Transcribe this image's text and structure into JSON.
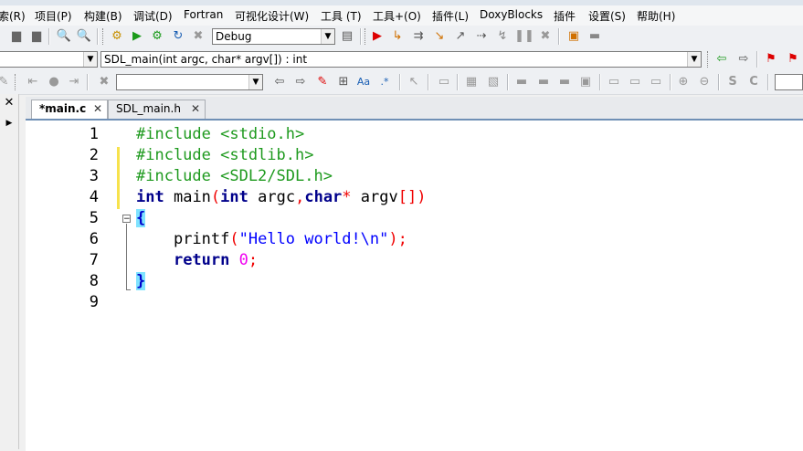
{
  "menu": [
    "索(R)",
    "项目(P)",
    "构建(B)",
    "调试(D)",
    "Fortran",
    "可视化设计(W)",
    "工具 (T)",
    "工具+(O)",
    "插件(L)",
    "DoxyBlocks",
    "插件",
    "设置(S)",
    "帮助(H)"
  ],
  "toolbar1": {
    "build_target": "Debug"
  },
  "toolbar2": {
    "symbol_combo": "SDL_main(int argc, char* argv[]) : int"
  },
  "toolbar3": {
    "search_value": ""
  },
  "tabs": [
    {
      "label": "*main.c",
      "active": true
    },
    {
      "label": "SDL_main.h",
      "active": false
    }
  ],
  "editor": {
    "line_numbers": [
      "1",
      "2",
      "3",
      "4",
      "5",
      "6",
      "7",
      "8",
      "9"
    ],
    "lines": [
      "#include <stdio.h>",
      "#include <stdlib.h>",
      "#include <SDL2/SDL.h>",
      "int main(int argc,char* argv[])",
      "{",
      "    printf(\"Hello world!\\n\");",
      "    return 0;",
      "}",
      ""
    ]
  },
  "colors": {
    "preprocessor": "#1e9a1e",
    "keyword": "#00008b",
    "string": "#0000ff",
    "number": "#f000f0",
    "operator": "#f00000",
    "brace_match": "#7fe3ff",
    "change_marker": "#f7e24c"
  }
}
